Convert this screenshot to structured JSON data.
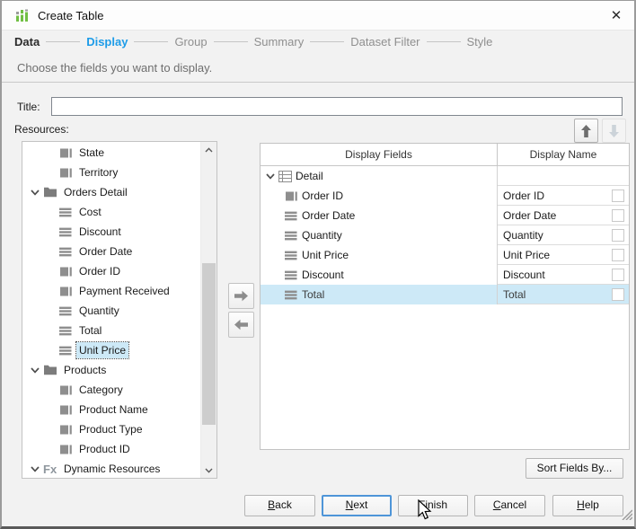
{
  "window": {
    "title": "Create Table",
    "close_glyph": "✕"
  },
  "wizard": {
    "steps": [
      {
        "label": "Data"
      },
      {
        "label": "Display"
      },
      {
        "label": "Group"
      },
      {
        "label": "Summary"
      },
      {
        "label": "Dataset Filter"
      },
      {
        "label": "Style"
      }
    ],
    "active_step": "Display",
    "description": "Choose the fields you want to display."
  },
  "title_field": {
    "label": "Title:",
    "value": ""
  },
  "resources": {
    "label": "Resources:",
    "fx_glyph": "Fx",
    "selected_item": "Unit Price",
    "items": [
      {
        "label": "State",
        "icon": "string-field"
      },
      {
        "label": "Territory",
        "icon": "string-field"
      },
      {
        "label": "Orders Detail",
        "icon": "folder",
        "expanded": true
      },
      {
        "label": "Cost",
        "icon": "numeric-field"
      },
      {
        "label": "Discount",
        "icon": "numeric-field"
      },
      {
        "label": "Order Date",
        "icon": "numeric-field"
      },
      {
        "label": "Order ID",
        "icon": "string-field"
      },
      {
        "label": "Payment Received",
        "icon": "string-field"
      },
      {
        "label": "Quantity",
        "icon": "numeric-field"
      },
      {
        "label": "Total",
        "icon": "numeric-field"
      },
      {
        "label": "Unit Price",
        "icon": "numeric-field",
        "selected": true
      },
      {
        "label": "Products",
        "icon": "folder",
        "expanded": true
      },
      {
        "label": "Category",
        "icon": "string-field"
      },
      {
        "label": "Product Name",
        "icon": "string-field"
      },
      {
        "label": "Product Type",
        "icon": "string-field"
      },
      {
        "label": "Product ID",
        "icon": "string-field"
      },
      {
        "label": "Dynamic Resources",
        "icon": "fx",
        "expanded": true
      }
    ]
  },
  "display_table": {
    "columns": [
      "Display Fields",
      "Display Name"
    ],
    "selected_row": "Total",
    "rows": [
      {
        "field": "Detail",
        "icon": "table",
        "display_name": ""
      },
      {
        "field": "Order ID",
        "icon": "string-field",
        "display_name": "Order ID",
        "checked": false
      },
      {
        "field": "Order Date",
        "icon": "numeric-field",
        "display_name": "Order Date",
        "checked": false
      },
      {
        "field": "Quantity",
        "icon": "numeric-field",
        "display_name": "Quantity",
        "checked": false
      },
      {
        "field": "Unit Price",
        "icon": "numeric-field",
        "display_name": "Unit Price",
        "checked": false
      },
      {
        "field": "Discount",
        "icon": "numeric-field",
        "display_name": "Discount",
        "checked": false
      },
      {
        "field": "Total",
        "icon": "numeric-field",
        "display_name": "Total",
        "checked": false
      }
    ]
  },
  "buttons": {
    "sort_fields": "Sort Fields By...",
    "back": "Back",
    "next": "Next",
    "finish": "Finish",
    "cancel": "Cancel",
    "help": "Help"
  },
  "colors": {
    "accent_blue": "#1d9ce8",
    "selection_blue": "#cde9f7",
    "icon_green": "#71bf44"
  }
}
